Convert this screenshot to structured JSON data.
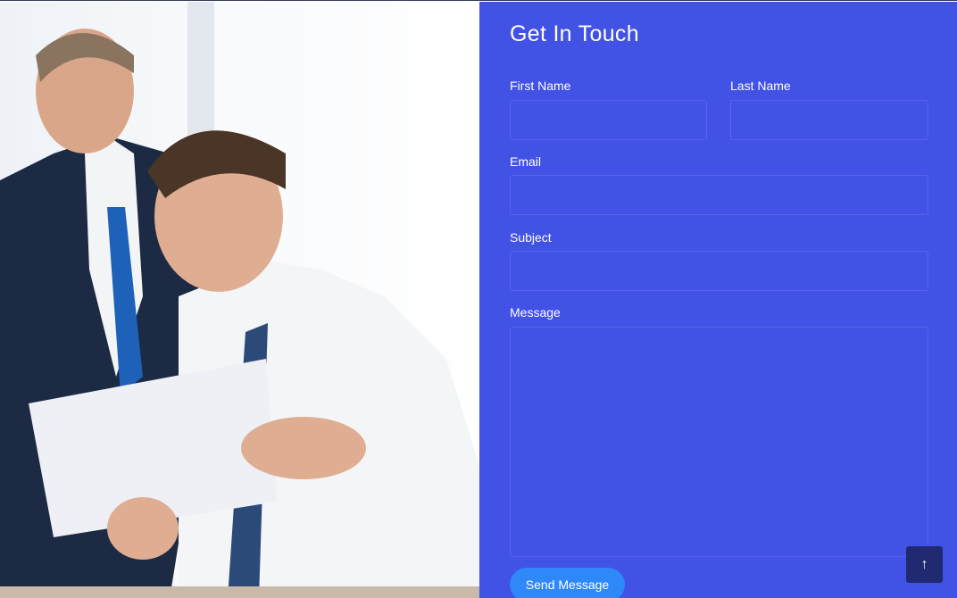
{
  "contact": {
    "title": "Get In Touch",
    "fields": {
      "first_name": "First Name",
      "last_name": "Last Name",
      "email": "Email",
      "subject": "Subject",
      "message": "Message"
    },
    "send_label": "Send Message"
  },
  "back_to_top": {
    "icon": "arrow-up-icon",
    "glyph": "↑"
  },
  "colors": {
    "panel": "#4152e4",
    "button": "#2f88f7",
    "back_to_top": "#202a70"
  }
}
